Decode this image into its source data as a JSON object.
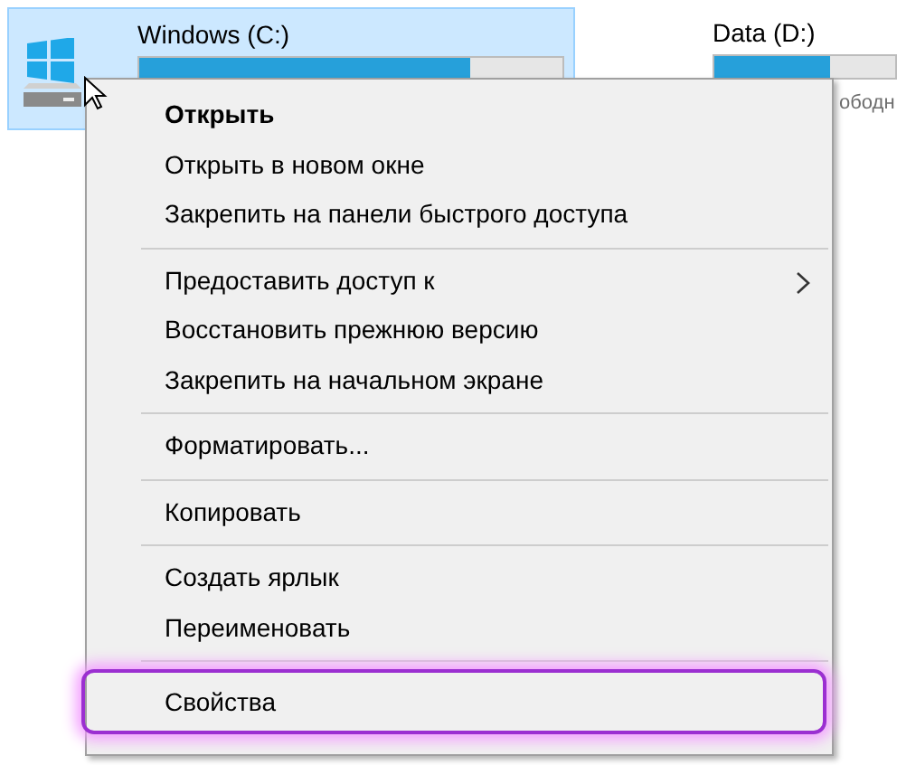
{
  "drives": [
    {
      "label": "Windows (C:)",
      "level": 0.78,
      "selected": true
    },
    {
      "label": "Data (D:)",
      "level": 0.64,
      "selected": false,
      "caption": "ободн"
    }
  ],
  "context_menu": {
    "items": [
      {
        "kind": "item",
        "label": "Открыть",
        "bold": true,
        "submenu": false,
        "highlighted": false
      },
      {
        "kind": "item",
        "label": "Открыть в новом окне",
        "bold": false,
        "submenu": false,
        "highlighted": false
      },
      {
        "kind": "item",
        "label": "Закрепить на панели быстрого доступа",
        "bold": false,
        "submenu": false,
        "highlighted": false
      },
      {
        "kind": "separator"
      },
      {
        "kind": "item",
        "label": "Предоставить доступ к",
        "bold": false,
        "submenu": true,
        "highlighted": false
      },
      {
        "kind": "item",
        "label": "Восстановить прежнюю версию",
        "bold": false,
        "submenu": false,
        "highlighted": false
      },
      {
        "kind": "item",
        "label": "Закрепить на начальном экране",
        "bold": false,
        "submenu": false,
        "highlighted": false
      },
      {
        "kind": "separator"
      },
      {
        "kind": "item",
        "label": "Форматировать...",
        "bold": false,
        "submenu": false,
        "highlighted": false
      },
      {
        "kind": "separator"
      },
      {
        "kind": "item",
        "label": "Копировать",
        "bold": false,
        "submenu": false,
        "highlighted": false
      },
      {
        "kind": "separator"
      },
      {
        "kind": "item",
        "label": "Создать ярлык",
        "bold": false,
        "submenu": false,
        "highlighted": false
      },
      {
        "kind": "item",
        "label": "Переименовать",
        "bold": false,
        "submenu": false,
        "highlighted": false
      },
      {
        "kind": "separator"
      },
      {
        "kind": "item",
        "label": "Свойства",
        "bold": false,
        "submenu": false,
        "highlighted": true
      }
    ]
  }
}
